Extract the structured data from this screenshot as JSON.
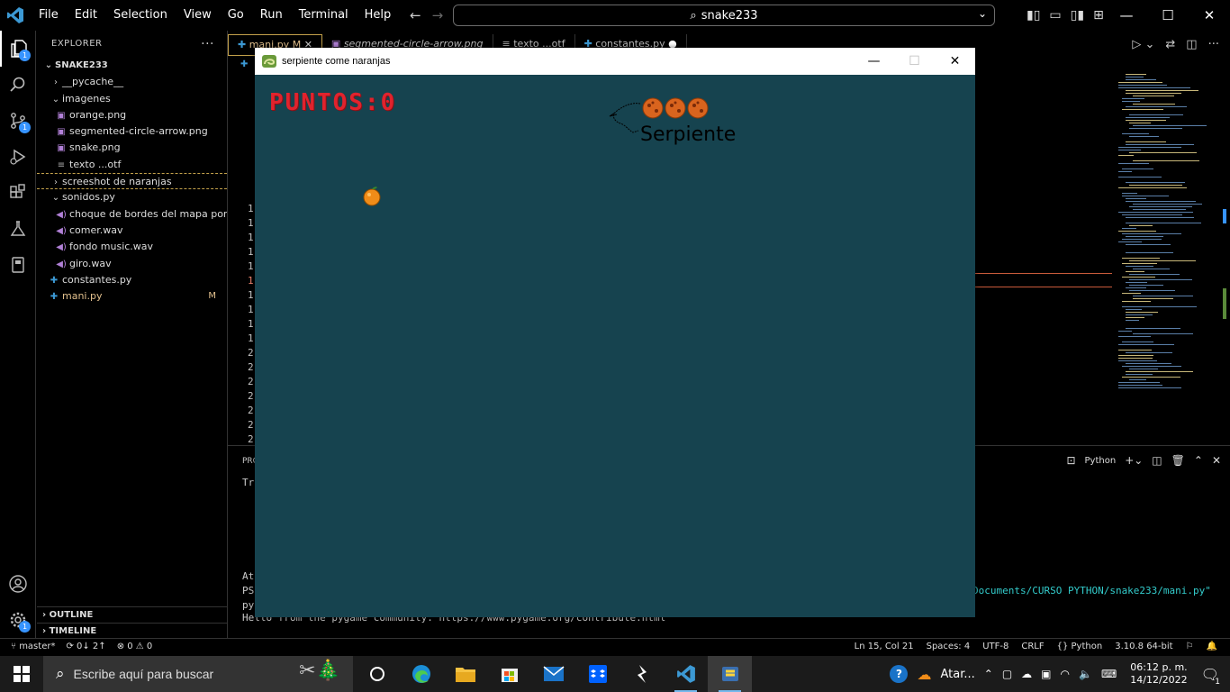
{
  "titlebar": {
    "menu": [
      "File",
      "Edit",
      "Selection",
      "View",
      "Go",
      "Run",
      "Terminal",
      "Help"
    ],
    "search_text": "snake233"
  },
  "activity": {
    "scm_badge": "1",
    "explorer_badge": "1",
    "settings_badge": "1"
  },
  "sidebar": {
    "header": "EXPLORER",
    "root": "SNAKE233",
    "items": [
      {
        "label": "__pycache__",
        "kind": "folder",
        "depth": 1,
        "open": false
      },
      {
        "label": "imagenes",
        "kind": "folder",
        "depth": 1,
        "open": true
      },
      {
        "label": "orange.png",
        "kind": "image",
        "depth": 2
      },
      {
        "label": "segmented-circle-arrow.png",
        "kind": "image",
        "depth": 2
      },
      {
        "label": "snake.png",
        "kind": "image",
        "depth": 2
      },
      {
        "label": "texto ...otf",
        "kind": "text",
        "depth": 2
      },
      {
        "label": "screeshot de naranjas",
        "kind": "folder",
        "depth": 1,
        "open": false
      },
      {
        "label": "sonidos.py",
        "kind": "folder",
        "depth": 1,
        "open": true
      },
      {
        "label": "choque de bordes del mapa por ca...",
        "kind": "sound",
        "depth": 2
      },
      {
        "label": "comer.wav",
        "kind": "sound",
        "depth": 2
      },
      {
        "label": "fondo music.wav",
        "kind": "sound",
        "depth": 2
      },
      {
        "label": "giro.wav",
        "kind": "sound",
        "depth": 2
      },
      {
        "label": "constantes.py",
        "kind": "python",
        "depth": 1
      },
      {
        "label": "mani.py",
        "kind": "python",
        "depth": 1,
        "modified": "M"
      }
    ],
    "outline": "OUTLINE",
    "timeline": "TIMELINE"
  },
  "tabs": [
    {
      "label": "mani.py",
      "status": "M",
      "active": true,
      "italic": false
    },
    {
      "label": "segmented-circle-arrow.png",
      "status": "",
      "active": false,
      "italic": true
    },
    {
      "label": "texto ...otf",
      "status": "",
      "active": false,
      "italic": false
    },
    {
      "label": "constantes.py",
      "status": "●",
      "active": false,
      "italic": false
    }
  ],
  "editor": {
    "line_numbers": [
      "1",
      "1",
      "1",
      "1",
      "1",
      "1",
      "1",
      "1",
      "1",
      "1",
      "2",
      "2",
      "2",
      "2",
      "2",
      "2",
      "2"
    ]
  },
  "panel": {
    "title": "PRO",
    "shell": "Python",
    "lines": {
      "t1": "Tr",
      "t2": "At",
      "t3": "PS",
      "t4": "py",
      "t5": "Hello from the pygame community. https://www.pygame.org/contribute.html",
      "path": "Documents/CURSO PYTHON/snake233/mani.py\""
    }
  },
  "game": {
    "window_title": "serpiente come naranjas",
    "score": "PUNTOS:0",
    "logo_text": "Serpiente",
    "bg_color": "#16434f",
    "score_color": "#e0232d"
  },
  "statusbar": {
    "branch": "master*",
    "sync": "0↓ 2↑",
    "problems": "⊗ 0 ⚠ 0",
    "position": "Ln 15, Col 21",
    "spaces": "Spaces: 4",
    "encoding": "UTF-8",
    "eol": "CRLF",
    "language": "Python",
    "interpreter": "3.10.8 64-bit"
  },
  "taskbar": {
    "search_placeholder": "Escribe aquí para buscar",
    "weather": "Atar...",
    "time": "06:12 p. m.",
    "date": "14/12/2022",
    "notif_count": "1"
  }
}
